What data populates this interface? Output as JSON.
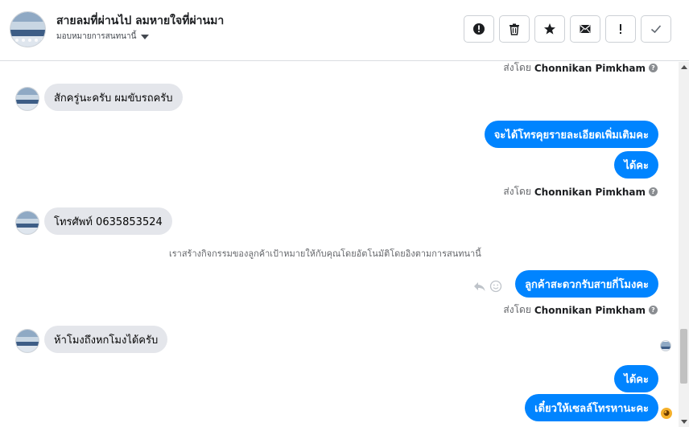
{
  "header": {
    "title": "สายลมที่ผ่านไป ลมหายใจที่ผ่านมา",
    "assign_label": "มอบหมายการสนทนานี้",
    "actions": [
      {
        "icon": "alert-circle-icon",
        "name": "mark-spam-button"
      },
      {
        "icon": "trash-icon",
        "name": "delete-button"
      },
      {
        "icon": "star-icon",
        "name": "star-button"
      },
      {
        "icon": "envelope-icon",
        "name": "mark-unread-button"
      },
      {
        "icon": "exclamation-icon",
        "name": "follow-up-button"
      },
      {
        "icon": "check-icon",
        "name": "mark-done-button"
      }
    ]
  },
  "thread": {
    "sent_by_prefix": "ส่งโดย",
    "agent_name": "Chonnikan Pimkham",
    "messages": [
      {
        "direction": "in",
        "text": "สักครู่นะครับ ผมขับรถครับ"
      },
      {
        "direction": "out",
        "text": "จะได้โทรคุยรายละเอียดเพิ่มเติมคะ"
      },
      {
        "direction": "out",
        "text": "ได้คะ"
      },
      {
        "direction": "in",
        "text": "โทรศัพท์ 0635853524"
      },
      {
        "direction": "system",
        "text": "เราสร้างกิจกรรมของลูกค้าเป้าหมายให้กับคุณโดยอัตโนมัติโดยอิงตามการสนทนานี้"
      },
      {
        "direction": "out",
        "text": "ลูกค้าสะดวกรับสายกี่โมงคะ"
      },
      {
        "direction": "in",
        "text": "ห้าโมงถึงหกโมงได้ครับ"
      },
      {
        "direction": "out",
        "text": "ได้คะ"
      },
      {
        "direction": "out",
        "text": "เดี๋ยวให้เซลล์โทรหานะคะ"
      }
    ]
  },
  "colors": {
    "outgoing_bubble": "#0084ff",
    "incoming_bubble": "#e4e6eb",
    "secondary_text": "#65676b"
  }
}
